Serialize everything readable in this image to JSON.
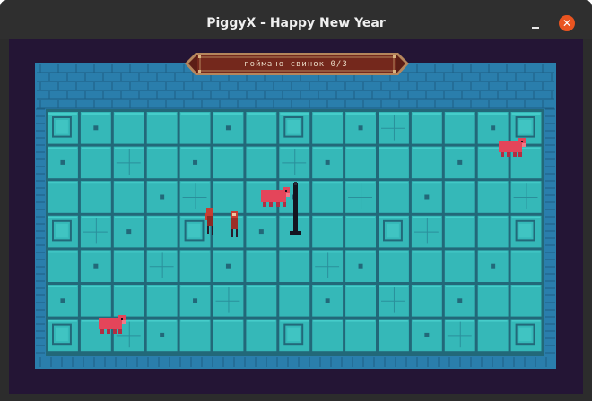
{
  "window": {
    "title": "PiggyX - Happy New Year",
    "minimize_glyph": "–",
    "close_glyph": "✕"
  },
  "hud": {
    "caught_text": "поймано свинок 0/3"
  },
  "colors": {
    "titlebar": "#2f2f2f",
    "close_button": "#e95420",
    "game_background": "#241535",
    "wall_blue": "#2579a8",
    "floor_teal": "#35b8b8",
    "tile_teal": "#40c4c2",
    "grout": "#226879",
    "banner_red": "#74281c",
    "banner_trim": "#b5865c",
    "pig_pink": "#e4455a",
    "player_red": "#c73d32"
  },
  "icons": {
    "minimize": "minimize-icon",
    "close": "close-icon",
    "pig": "pig-icon",
    "player": "player-character",
    "npc": "npc-character",
    "post": "lamp-post"
  },
  "level": {
    "pigs_total": 3,
    "pigs_caught": 0
  }
}
